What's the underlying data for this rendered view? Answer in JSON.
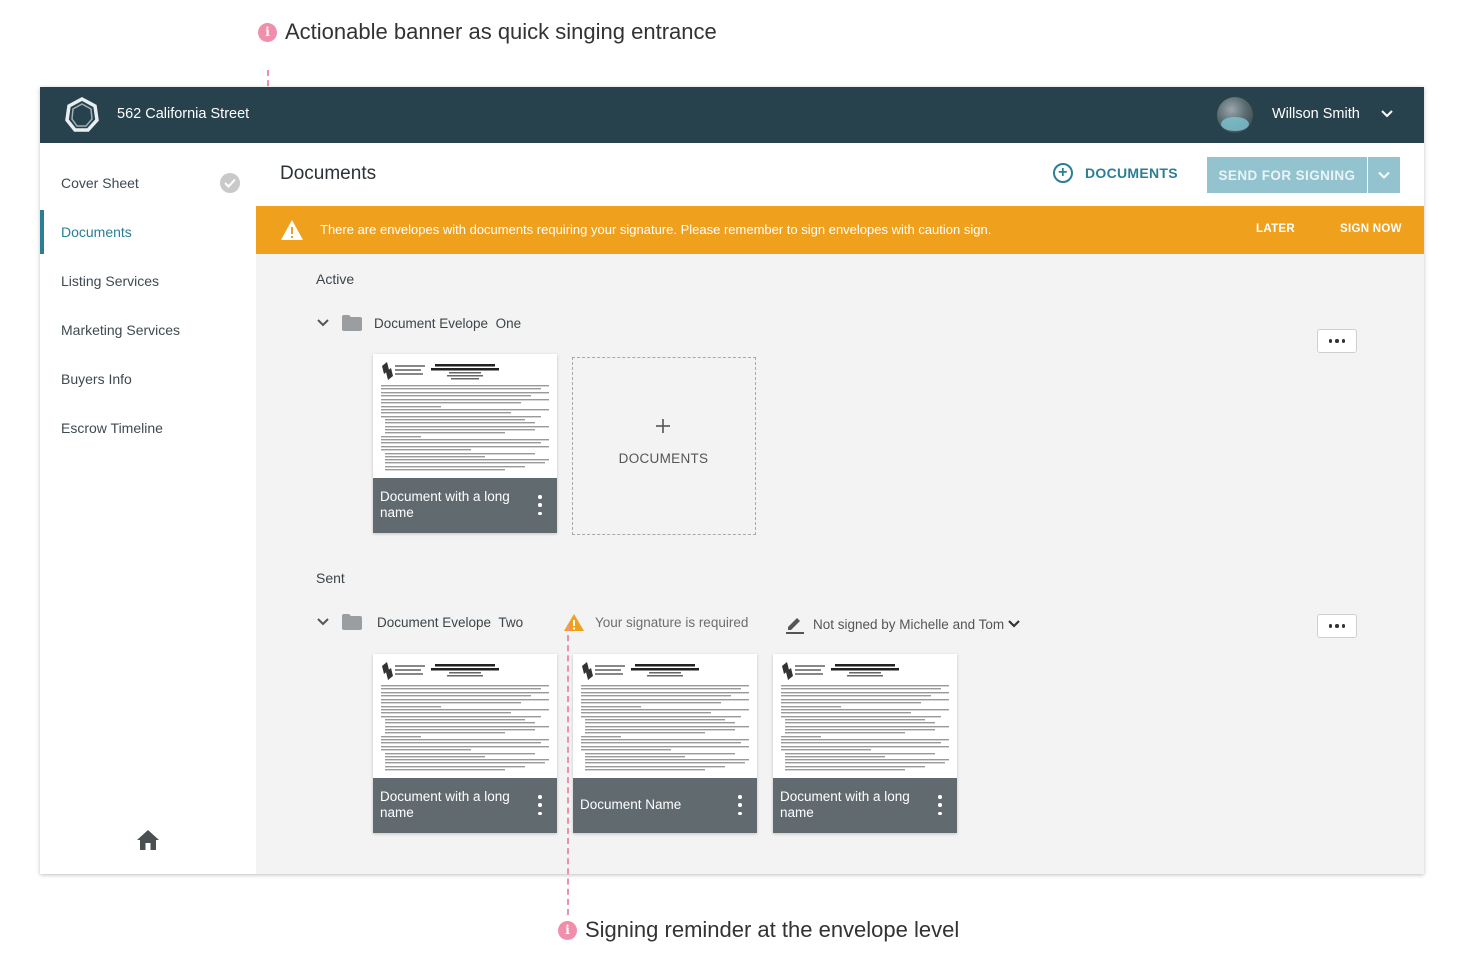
{
  "annotations": {
    "top": "Actionable banner as quick singing entrance",
    "bottom": "Signing reminder at the envelope level"
  },
  "topbar": {
    "address": "562 California Street",
    "user_name": "Willson Smith"
  },
  "sidebar": {
    "items": [
      {
        "label": "Cover Sheet",
        "completed": true
      },
      {
        "label": "Documents",
        "active": true
      },
      {
        "label": "Listing Services"
      },
      {
        "label": "Marketing Services"
      },
      {
        "label": "Buyers Info"
      },
      {
        "label": "Escrow Timeline"
      }
    ]
  },
  "header": {
    "title": "Documents",
    "add_documents_label": "DOCUMENTS",
    "send_for_signing_label": "SEND FOR SIGNING"
  },
  "banner": {
    "message": "There are envelopes with documents requiring your signature. Please remember to sign envelopes with caution sign.",
    "later_label": "LATER",
    "sign_now_label": "SIGN NOW",
    "color": "#efa11e"
  },
  "sections": {
    "active": {
      "label": "Active",
      "envelope_name": "Document Evelope  One",
      "documents": [
        {
          "name": "Document with a long name"
        }
      ],
      "add_card_label": "DOCUMENTS"
    },
    "sent": {
      "label": "Sent",
      "envelope_name": "Document Evelope  Two",
      "signature_required": "Your signature is required",
      "not_signed_status": "Not signed by Michelle and Tom",
      "documents": [
        {
          "name": "Document with a long name"
        },
        {
          "name": "Document Name"
        },
        {
          "name": "Document with a long name"
        }
      ]
    }
  },
  "colors": {
    "topbar": "#27414d",
    "accent": "#2a7f94",
    "annotation": "#ef8fac",
    "warning": "#efa11e"
  }
}
